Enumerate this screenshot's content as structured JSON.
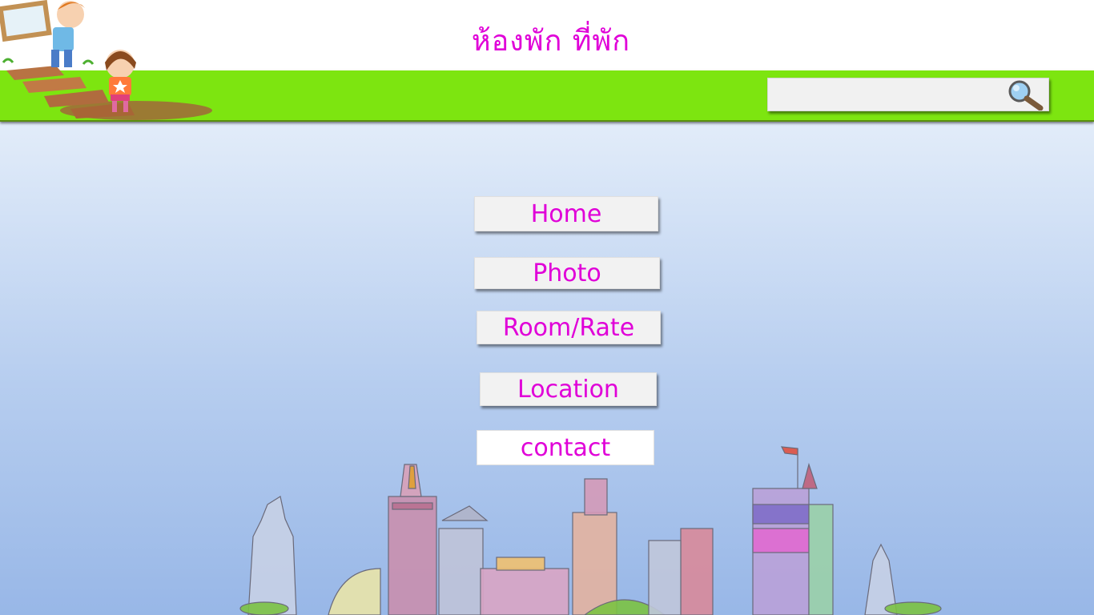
{
  "header": {
    "title": "ห้องพัก ที่พัก"
  },
  "search": {
    "value": "",
    "placeholder": ""
  },
  "menu": {
    "items": [
      {
        "label": "Home"
      },
      {
        "label": "Photo"
      },
      {
        "label": "Room/Rate"
      },
      {
        "label": "Location"
      },
      {
        "label": "contact"
      }
    ]
  },
  "icons": {
    "search": "magnifier-icon"
  },
  "colors": {
    "accent": "#e000d8",
    "bar": "#7de510"
  }
}
